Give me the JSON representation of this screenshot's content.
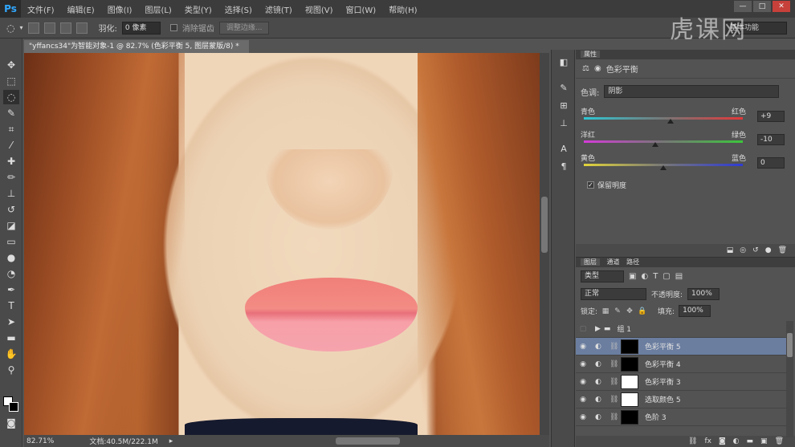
{
  "app": {
    "logo": "Ps"
  },
  "menu": [
    "文件(F)",
    "编辑(E)",
    "图像(I)",
    "图层(L)",
    "类型(Y)",
    "选择(S)",
    "滤镜(T)",
    "视图(V)",
    "窗口(W)",
    "帮助(H)"
  ],
  "window_controls": {
    "minimize": "—",
    "maximize": "□",
    "close": "✕"
  },
  "options": {
    "feather_label": "羽化:",
    "feather_value": "0 像素",
    "antialias_label": "消除锯齿",
    "refine_edge_button": "调整边缘...",
    "workspace": "基本功能"
  },
  "watermark": "虎课网",
  "document": {
    "tab_title": "\"yffancs34\"为智能对象-1 @ 82.7% (色彩平衡 5, 图层蒙版/8) *",
    "zoom": "82.71%",
    "doc_size": "文档:40.5M/222.1M"
  },
  "properties": {
    "tab": "属性",
    "title": "色彩平衡",
    "tone_label": "色调:",
    "tone_value": "阴影",
    "sliders": [
      {
        "left": "青色",
        "right": "红色",
        "value": "+9",
        "position": 0.545,
        "gradient": "linear-gradient(90deg,#2ec7d4,#777,#e2383a)"
      },
      {
        "left": "洋红",
        "right": "绿色",
        "value": "-10",
        "position": 0.45,
        "gradient": "linear-gradient(90deg,#d43bd8,#777,#3bc63b)"
      },
      {
        "left": "黄色",
        "right": "蓝色",
        "value": "0",
        "position": 0.5,
        "gradient": "linear-gradient(90deg,#e2d43a,#777,#2f3bd4)"
      }
    ],
    "preserve_label": "保留明度",
    "preserve_checked": "✓"
  },
  "layers_panel": {
    "tabs": [
      "图层",
      "通道",
      "路径"
    ],
    "filter_type": "类型",
    "blend_mode": "正常",
    "opacity_label": "不透明度:",
    "opacity_value": "100%",
    "lock_label": "锁定:",
    "fill_label": "填充:",
    "fill_value": "100%",
    "group_name": "组 1",
    "layers": [
      {
        "name": "色彩平衡 5",
        "mask": "black",
        "selected": true
      },
      {
        "name": "色彩平衡 4",
        "mask": "black",
        "selected": false
      },
      {
        "name": "色彩平衡 3",
        "mask": "white",
        "selected": false
      },
      {
        "name": "选取颜色 5",
        "mask": "white",
        "selected": false
      },
      {
        "name": "色阶 3",
        "mask": "black",
        "selected": false
      }
    ]
  }
}
